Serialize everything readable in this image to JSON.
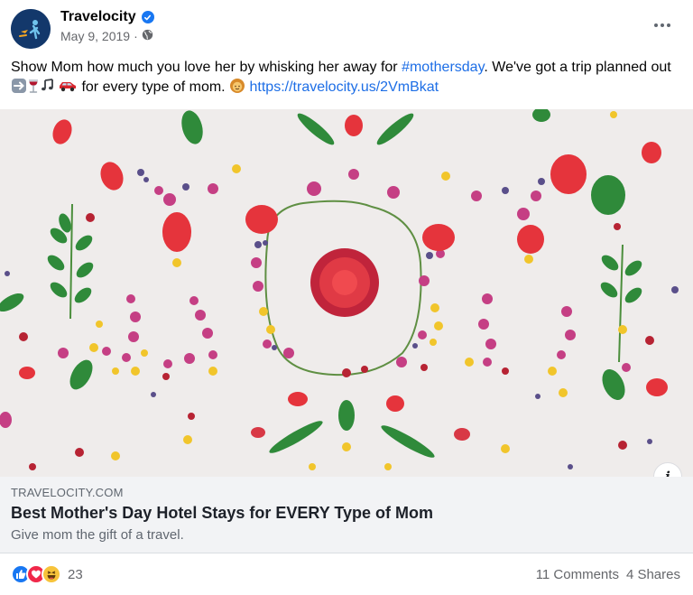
{
  "post": {
    "page_name": "Travelocity",
    "date": "May 9, 2019",
    "separator": "·",
    "text_before_hashtag": "Show Mom how much you love her by whisking her away for ",
    "hashtag": "#mothersday",
    "text_after_hashtag": ". We've got a trip planned out ",
    "text_after_emojis": " for every type of mom. ",
    "link_url": "https://travelocity.us/2VmBkat",
    "emojis": [
      "arrow-right-emoji",
      "wine-glass-emoji",
      "music-notes-emoji",
      "car-emoji",
      "woman-emoji"
    ]
  },
  "link_card": {
    "domain": "TRAVELOCITY.COM",
    "title": "Best Mother's Day Hotel Stays for EVERY Type of Mom",
    "description": "Give mom the gift of a travel."
  },
  "footer": {
    "reaction_count": "23",
    "comments": "11 Comments",
    "shares": "4 Shares",
    "reactions": [
      "like-reaction-icon",
      "love-reaction-icon",
      "haha-reaction-icon"
    ]
  },
  "colors": {
    "accent": "#1877f2",
    "link": "#1d6ee6",
    "petal_red": "#e5343c",
    "petal_pink": "#c53f84",
    "leaf_green": "#2f8a3a",
    "flower_yellow": "#f1c52b"
  }
}
